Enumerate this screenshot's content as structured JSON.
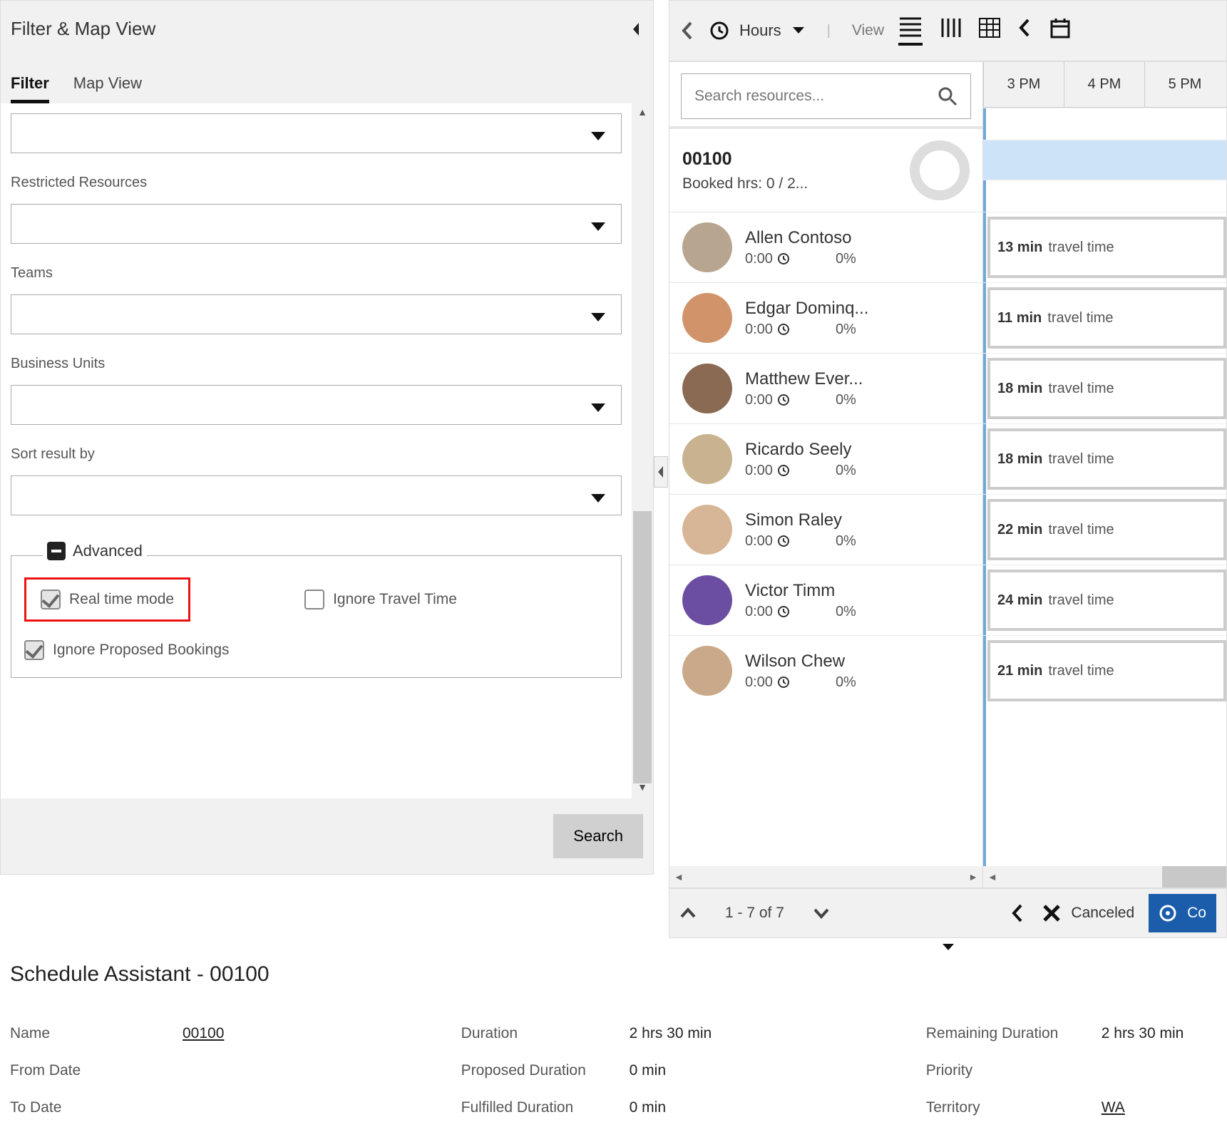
{
  "left": {
    "title": "Filter & Map View",
    "tabs": {
      "filter": "Filter",
      "map": "Map View"
    },
    "fields": {
      "restricted": "Restricted Resources",
      "teams": "Teams",
      "business": "Business Units",
      "sort": "Sort result by"
    },
    "advanced": {
      "legend": "Advanced",
      "realtime": "Real time mode",
      "ignore_travel": "Ignore Travel Time",
      "ignore_proposed": "Ignore Proposed Bookings"
    },
    "search_btn": "Search"
  },
  "right": {
    "hours": "Hours",
    "view": "View",
    "search_placeholder": "Search resources...",
    "work_order": {
      "id": "00100",
      "booked": "Booked hrs: 0 / 2..."
    },
    "time_header": [
      "3 PM",
      "4 PM",
      "5 PM"
    ],
    "resources": [
      {
        "name": "Allen Contoso",
        "time": "0:00",
        "pct": "0%",
        "travel": "13 min",
        "avatar": "#b7a58f"
      },
      {
        "name": "Edgar Dominq...",
        "time": "0:00",
        "pct": "0%",
        "travel": "11 min",
        "avatar": "#d1946a"
      },
      {
        "name": "Matthew Ever...",
        "time": "0:00",
        "pct": "0%",
        "travel": "18 min",
        "avatar": "#8a6a53"
      },
      {
        "name": "Ricardo Seely",
        "time": "0:00",
        "pct": "0%",
        "travel": "18 min",
        "avatar": "#c9b28f"
      },
      {
        "name": "Simon Raley",
        "time": "0:00",
        "pct": "0%",
        "travel": "22 min",
        "avatar": "#d7b698"
      },
      {
        "name": "Victor Timm",
        "time": "0:00",
        "pct": "0%",
        "travel": "24 min",
        "avatar": "#6b4ea1"
      },
      {
        "name": "Wilson Chew",
        "time": "0:00",
        "pct": "0%",
        "travel": "21 min",
        "avatar": "#caa98a"
      }
    ],
    "travel_label": "travel time",
    "pager": "1 - 7 of 7",
    "legend_canceled": "Canceled",
    "legend_co": "Co"
  },
  "details": {
    "title": "Schedule Assistant - 00100",
    "rows": {
      "name_lbl": "Name",
      "name_val": "00100",
      "from_lbl": "From Date",
      "to_lbl": "To Date",
      "duration_lbl": "Duration",
      "duration_val": "2 hrs 30 min",
      "proposed_lbl": "Proposed Duration",
      "proposed_val": "0 min",
      "fulfilled_lbl": "Fulfilled Duration",
      "fulfilled_val": "0 min",
      "remaining_lbl": "Remaining Duration",
      "remaining_val": "2 hrs 30 min",
      "priority_lbl": "Priority",
      "territory_lbl": "Territory",
      "territory_val": "WA"
    }
  }
}
